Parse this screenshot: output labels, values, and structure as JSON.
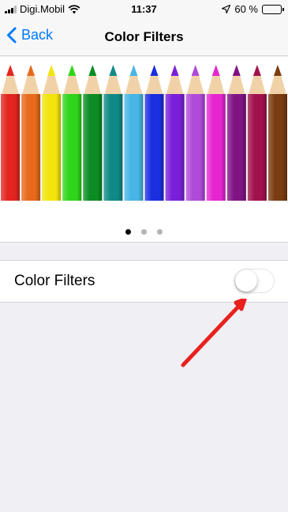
{
  "status_bar": {
    "carrier": "Digi.Mobil",
    "time": "11:37",
    "battery_text": "60 %",
    "battery_level": 0.6,
    "icons": [
      "signal-bars-icon",
      "wifi-icon",
      "location-arrow-icon",
      "battery-icon"
    ]
  },
  "nav": {
    "back_label": "Back",
    "title": "Color Filters"
  },
  "preview": {
    "pencil_colors": [
      "#e2251f",
      "#e76a1c",
      "#f2e40c",
      "#2ed51a",
      "#0c8d23",
      "#0f8a86",
      "#47b5e6",
      "#1a2fe0",
      "#7a1fd9",
      "#b04ad9",
      "#e625d0",
      "#801484",
      "#a0124d",
      "#7a3c10"
    ],
    "page_count": 3,
    "active_page": 0
  },
  "settings": {
    "color_filters_label": "Color Filters",
    "color_filters_enabled": false
  },
  "annotation": {
    "arrow_color": "#e8211c"
  }
}
